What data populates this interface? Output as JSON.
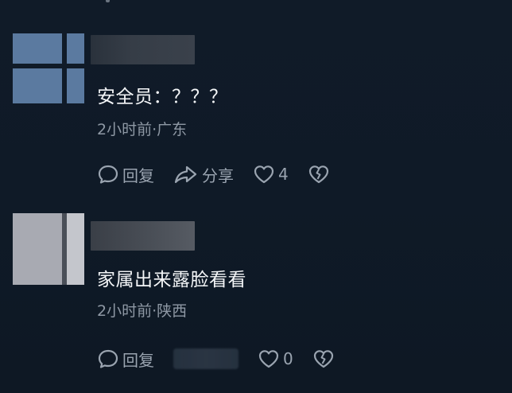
{
  "comments": [
    {
      "text": "安全员：？？？",
      "meta": "2小时前·广东",
      "actions": {
        "reply": "回复",
        "share": "分享",
        "likes": "4"
      }
    },
    {
      "text": "家属出来露脸看看",
      "meta": "2小时前·陕西",
      "actions": {
        "reply": "回复",
        "likes": "0"
      }
    }
  ],
  "colors": {
    "background": "#0f1a27",
    "text": "#f4f6f8",
    "meta": "#8e98a4",
    "icon": "#9aa4b0"
  }
}
